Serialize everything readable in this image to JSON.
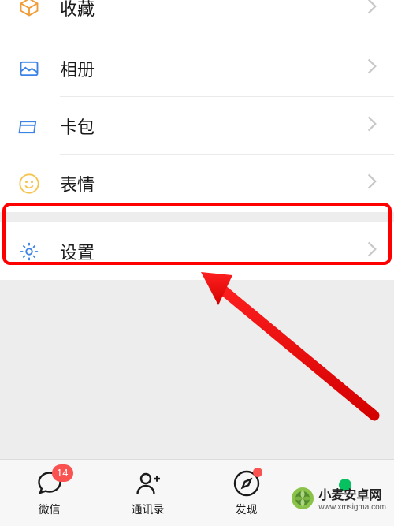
{
  "menu": {
    "favorites": {
      "label": "收藏"
    },
    "album": {
      "label": "相册"
    },
    "card": {
      "label": "卡包"
    },
    "sticker": {
      "label": "表情"
    },
    "settings": {
      "label": "设置"
    }
  },
  "tabs": {
    "wechat": {
      "label": "微信",
      "badge": "14"
    },
    "contacts": {
      "label": "通讯录"
    },
    "discover": {
      "label": "发现"
    }
  },
  "watermark": {
    "name": "小麦安卓网",
    "url": "www.xmsigma.com"
  }
}
